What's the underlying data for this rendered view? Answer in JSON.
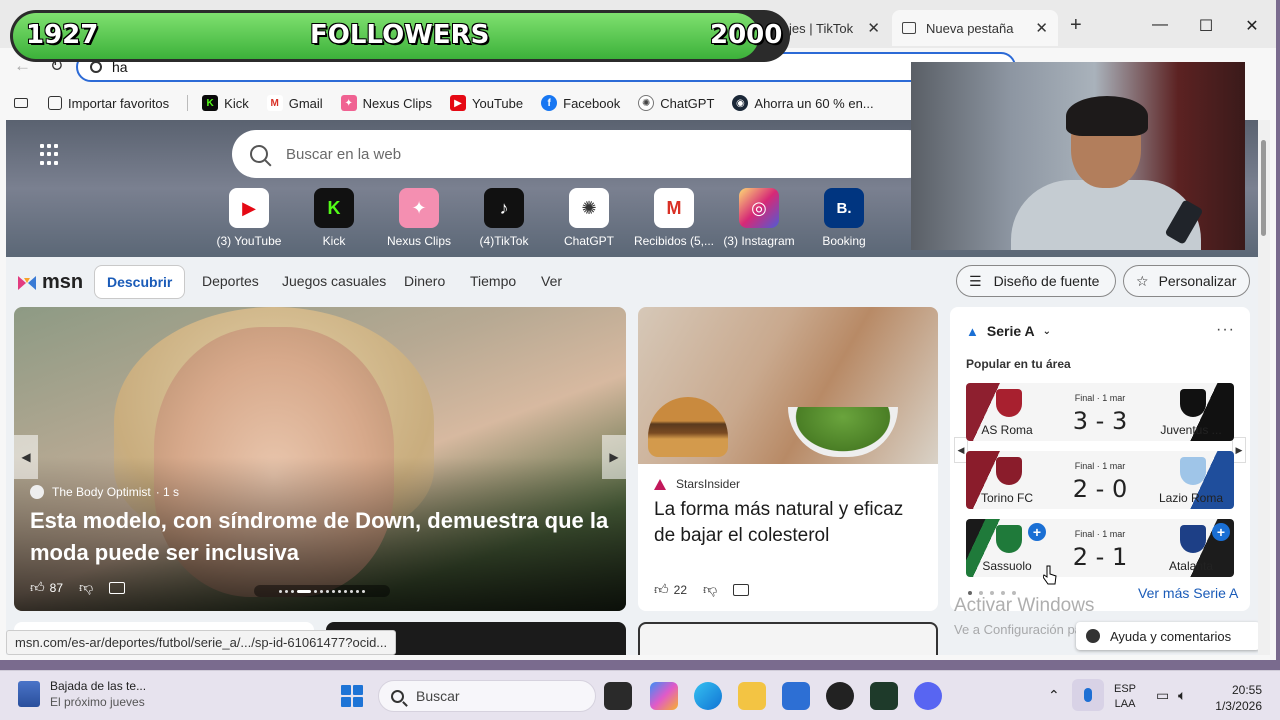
{
  "followers": {
    "current": "1927",
    "label": "FOLLOWERS",
    "goal": "2000",
    "progress": 0.9635
  },
  "tabs": [
    {
      "label": "Mensajes | TikTok"
    },
    {
      "label": "Nueva pestaña"
    }
  ],
  "address": {
    "value": "ha"
  },
  "favorites": [
    {
      "label": "Importar favoritos",
      "icon": "import-icon"
    },
    {
      "label": "Kick",
      "icon": "kick-icon",
      "color": "#0a0a0a"
    },
    {
      "label": "Gmail",
      "icon": "gmail-icon",
      "color": "#d93025"
    },
    {
      "label": "Nexus Clips",
      "icon": "nexus-icon",
      "color": "#f06292"
    },
    {
      "label": "YouTube",
      "icon": "youtube-icon",
      "color": "#e50914"
    },
    {
      "label": "Facebook",
      "icon": "facebook-icon",
      "color": "#1877f2"
    },
    {
      "label": "ChatGPT",
      "icon": "chatgpt-icon",
      "color": "#444444"
    },
    {
      "label": "Ahorra un 60 % en...",
      "icon": "steam-icon",
      "color": "#1b2838"
    }
  ],
  "search": {
    "placeholder": "Buscar en la web"
  },
  "quicklinks": [
    {
      "label": "(3) YouTube",
      "icon": "youtube-icon",
      "glyph": "▶",
      "color": "#e50914"
    },
    {
      "label": "Kick",
      "icon": "kick-icon",
      "glyph": "K",
      "color": "#53fc18"
    },
    {
      "label": "Nexus Clips",
      "icon": "nexus-icon",
      "glyph": "✦",
      "color": "#f06292"
    },
    {
      "label": "(4)TikTok",
      "icon": "tiktok-icon",
      "glyph": "♪",
      "color": "#111111"
    },
    {
      "label": "ChatGPT",
      "icon": "chatgpt-icon",
      "glyph": "✺",
      "color": "#333333"
    },
    {
      "label": "Recibidos (5,...",
      "icon": "gmail-icon",
      "glyph": "M",
      "color": "#d93025"
    },
    {
      "label": "(3) Instagram",
      "icon": "instagram-icon",
      "glyph": "◎",
      "color": "#c13584"
    },
    {
      "label": "Booking",
      "icon": "booking-icon",
      "glyph": "B.",
      "color": "#003580"
    }
  ],
  "msn": {
    "logo": "msn",
    "nav": [
      "Descubrir",
      "Deportes",
      "Juegos casuales",
      "Dinero",
      "Tiempo",
      "Ver"
    ],
    "font_button": "Diseño de fuente",
    "personalize_button": "Personalizar"
  },
  "hero": {
    "source": "The Body Optimist",
    "time": "· 1 s",
    "title": "Esta modelo, con síndrome de Down, demuestra que la moda puede ser inclusiva",
    "likes": "87"
  },
  "card2": {
    "source": "StarsInsider",
    "title": "La forma más natural y eficaz de bajar el colesterol",
    "likes": "22"
  },
  "widget": {
    "league": "Serie A",
    "popular": "Popular en tu área",
    "matches": [
      {
        "home": "AS Roma",
        "away": "Juventus ...",
        "status": "Final · 1 mar",
        "score": "3 - 3",
        "home_color": "#8e1f2f",
        "away_color": "#111111"
      },
      {
        "home": "Torino FC",
        "away": "Lazio Roma",
        "status": "Final · 1 mar",
        "score": "2 - 0",
        "home_color": "#8a1c2b",
        "away_color": "#1f4e9c"
      },
      {
        "home": "Sassuolo",
        "away": "Atalanta",
        "status": "Final · 1 mar",
        "score": "2 - 1",
        "home_color": "#1f7a3a",
        "away_color": "#1c1c1c"
      }
    ],
    "link": "Ver más Serie A"
  },
  "watermark": {
    "line1": "Activar Windows",
    "line2": "Ve a Configuración para activar Windows."
  },
  "feedback": "Ayuda y comentarios",
  "statusbar": "msn.com/es-ar/deportes/futbol/serie_a/.../sp-id-61061477?ocid...",
  "taskbar": {
    "weather_title": "Bajada de las te...",
    "weather_sub": "El próximo jueves",
    "search": "Buscar",
    "lang1": "ESP",
    "lang2": "LAA",
    "time": "20:55",
    "date": "1/3/2026"
  }
}
